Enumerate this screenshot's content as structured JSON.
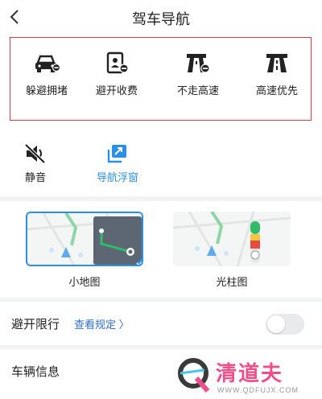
{
  "header": {
    "title": "驾车导航"
  },
  "route_prefs": [
    {
      "label": "躲避拥堵",
      "icon": "car-avoid-congestion-icon"
    },
    {
      "label": "避开收费",
      "icon": "avoid-toll-icon"
    },
    {
      "label": "不走高速",
      "icon": "no-highway-icon"
    },
    {
      "label": "高速优先",
      "icon": "highway-first-icon"
    }
  ],
  "options": {
    "mute": {
      "label": "静音",
      "icon": "mute-speaker-icon"
    },
    "float": {
      "label": "导航浮窗",
      "icon": "floating-window-icon"
    }
  },
  "map_styles": [
    {
      "label": "小地图",
      "selected": true
    },
    {
      "label": "光柱图",
      "selected": false
    }
  ],
  "restriction": {
    "label": "避开限行",
    "link": "查看规定 〉",
    "enabled": false
  },
  "vehicle": {
    "label": "车辆信息"
  },
  "watermark": {
    "brand": "清道夫",
    "url": "WWW.QDFUJX.COM"
  },
  "colors": {
    "accent": "#2b8fe8",
    "highlight_box": "#e23a3a",
    "link": "#2b6fd6"
  }
}
